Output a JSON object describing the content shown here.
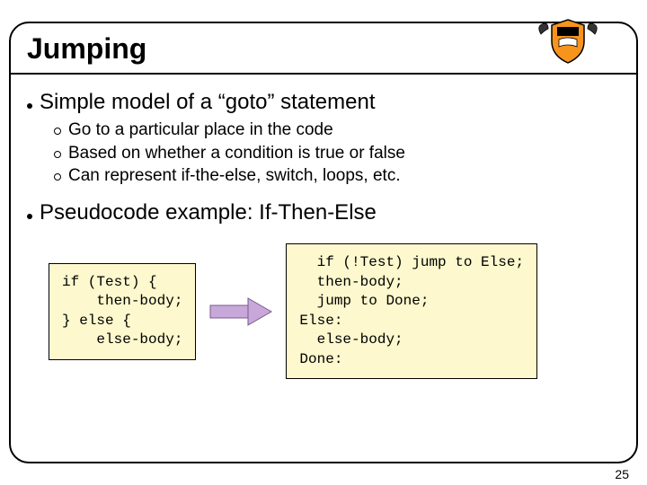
{
  "title": "Jumping",
  "bullets": [
    {
      "text": "Simple model of a “goto” statement",
      "sub": [
        "Go to a particular place in the code",
        "Based on whether a condition is true or false",
        "Can represent if-the-else, switch, loops, etc."
      ]
    },
    {
      "text": "Pseudocode example: If-Then-Else",
      "sub": []
    }
  ],
  "code_left": "if (Test) {\n    then-body;\n} else {\n    else-body;",
  "code_right": "  if (!Test) jump to Else;\n  then-body;\n  jump to Done;\nElse:\n  else-body;\nDone:",
  "page_number": "25",
  "icons": {
    "crest": "princeton-crest-icon",
    "arrow": "right-arrow-icon"
  }
}
